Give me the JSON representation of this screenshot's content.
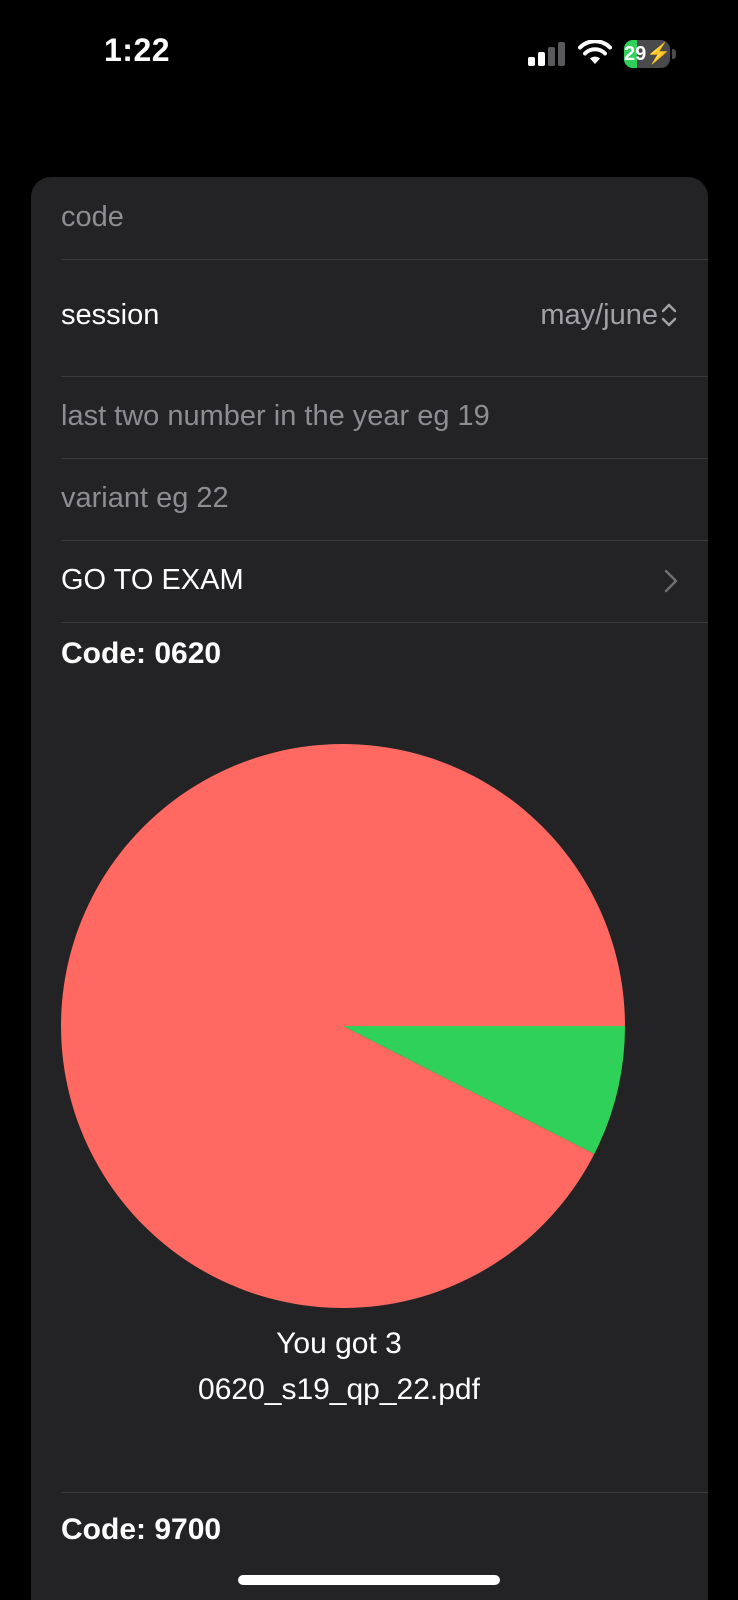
{
  "status_bar": {
    "time": "1:22",
    "battery_level": "29",
    "battery_fraction": 0.29,
    "cellular_bars_active": 2,
    "icons": [
      "signal-icon",
      "wifi-icon",
      "battery-icon",
      "charging-bolt-icon"
    ]
  },
  "form": {
    "code_placeholder": "code",
    "session_label": "session",
    "session_value": "may/june",
    "year_placeholder": "last two number in the year eg 19",
    "variant_placeholder": "variant eg 22",
    "go_button_label": "GO TO EXAM"
  },
  "results": [
    {
      "title": "Code: 0620",
      "score_text": "You got 3",
      "file_name": "0620_s19_qp_22.pdf"
    },
    {
      "title": "Code: 9700"
    }
  ],
  "chart_data": {
    "type": "pie",
    "values": [
      37,
      3
    ],
    "colors": [
      "#ff6961",
      "#30d158"
    ]
  },
  "colors": {
    "background": "#000000",
    "card": "#232325",
    "separator": "#3a3a3c",
    "placeholder": "#8d8d92",
    "wrong": "#ff6961",
    "correct": "#30d158"
  }
}
